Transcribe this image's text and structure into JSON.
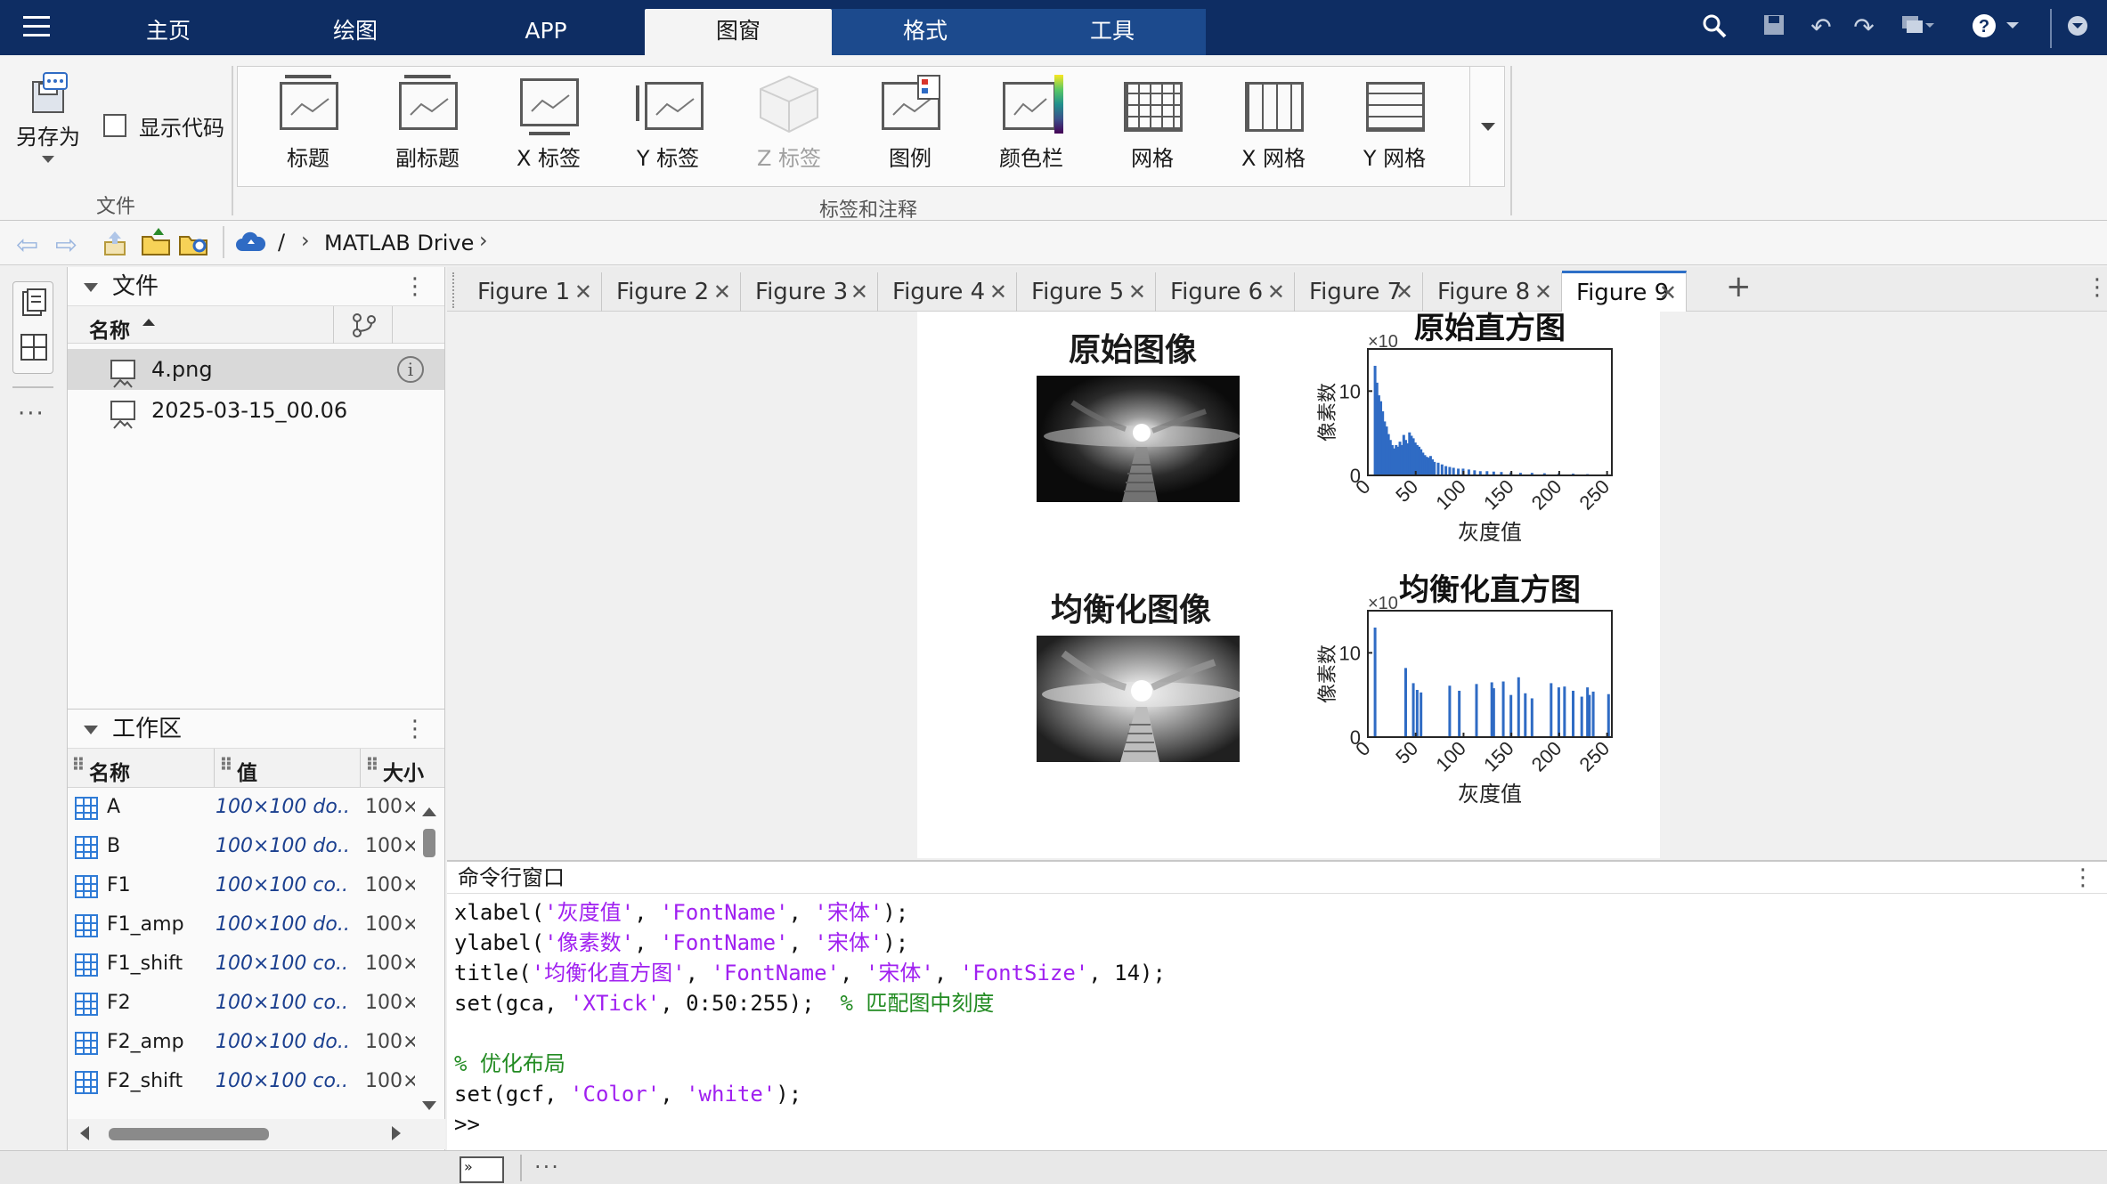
{
  "top_tabs": [
    "主页",
    "绘图",
    "APP",
    "图窗",
    "格式",
    "工具"
  ],
  "active_tab": "图窗",
  "ribbon": {
    "file_group": {
      "save_as": "另存为",
      "show_code": "显示代码",
      "group_label": "文件"
    },
    "label_group": {
      "buttons": [
        "标题",
        "副标题",
        "X 标签",
        "Y 标签",
        "Z 标签",
        "图例",
        "颜色栏",
        "网格",
        "X 网格",
        "Y 网格"
      ],
      "group_label": "标签和注释"
    }
  },
  "address": {
    "sep": "/",
    "path": "MATLAB Drive"
  },
  "files_panel": {
    "title": "文件",
    "col_name": "名称",
    "items": [
      "4.png",
      "2025-03-15_00.06"
    ]
  },
  "workspace": {
    "title": "工作区",
    "cols": [
      "名称",
      "值",
      "大小"
    ],
    "rows": [
      {
        "name": "A",
        "value": "100×100 do...",
        "size": "100×"
      },
      {
        "name": "B",
        "value": "100×100 do...",
        "size": "100×"
      },
      {
        "name": "F1",
        "value": "100×100 co...",
        "size": "100×"
      },
      {
        "name": "F1_amp",
        "value": "100×100 do...",
        "size": "100×"
      },
      {
        "name": "F1_shift",
        "value": "100×100 co...",
        "size": "100×"
      },
      {
        "name": "F2",
        "value": "100×100 co...",
        "size": "100×"
      },
      {
        "name": "F2_amp",
        "value": "100×100 do...",
        "size": "100×"
      },
      {
        "name": "F2_shift",
        "value": "100×100 co...",
        "size": "100×"
      }
    ]
  },
  "figure_tabs": [
    "Figure 1",
    "Figure 2",
    "Figure 3",
    "Figure 4",
    "Figure 5",
    "Figure 6",
    "Figure 7",
    "Figure 8",
    "Figure 9"
  ],
  "active_figure": "Figure 9",
  "figure": {
    "img1_title": "原始图像",
    "img2_title": "均衡化图像",
    "hist1_title": "原始直方图",
    "hist2_title": "均衡化直方图",
    "xlabel": "灰度值",
    "ylabel": "像素数",
    "exp_label": "×10",
    "ytick_top": "10",
    "ytick_zero": "0",
    "xticks": [
      "0",
      "50",
      "100",
      "150",
      "200",
      "250"
    ]
  },
  "chart_data": [
    {
      "type": "bar",
      "title": "原始直方图",
      "xlabel": "灰度值",
      "ylabel": "像素数",
      "xlim": [
        0,
        255
      ],
      "ylim": [
        0,
        15
      ],
      "x": [
        8,
        10,
        12,
        14,
        16,
        18,
        20,
        22,
        24,
        26,
        28,
        30,
        32,
        34,
        36,
        38,
        40,
        42,
        44,
        46,
        48,
        50,
        52,
        54,
        56,
        58,
        60,
        62,
        64,
        66,
        68,
        70,
        74,
        78,
        82,
        86,
        90,
        95,
        100,
        106,
        112,
        118,
        125,
        132,
        140,
        150,
        160,
        172,
        185,
        200,
        215,
        230,
        245
      ],
      "values": [
        13,
        11,
        9.5,
        8.8,
        7.6,
        6.4,
        5.8,
        4.9,
        4.2,
        3.6,
        3.2,
        3.6,
        3.4,
        4.0,
        3.6,
        4.8,
        4.2,
        3.8,
        5.1,
        4.7,
        4.4,
        3.9,
        3.6,
        3.4,
        3.1,
        2.7,
        2.4,
        2.2,
        2.1,
        2.3,
        1.9,
        1.6,
        1.5,
        1.3,
        1.1,
        1.0,
        0.9,
        0.8,
        0.8,
        0.7,
        0.6,
        0.5,
        0.5,
        0.45,
        0.4,
        0.35,
        0.3,
        0.3,
        0.25,
        0.2,
        0.2,
        0.15,
        0.1
      ]
    },
    {
      "type": "bar",
      "title": "均衡化直方图",
      "xlabel": "灰度值",
      "ylabel": "像素数",
      "xlim": [
        0,
        255
      ],
      "ylim": [
        0,
        15
      ],
      "x": [
        8,
        40,
        48,
        52,
        56,
        86,
        96,
        114,
        130,
        132,
        142,
        150,
        158,
        165,
        172,
        192,
        200,
        206,
        215,
        224,
        230,
        232,
        236,
        252
      ],
      "values": [
        13,
        8.2,
        6.4,
        5.6,
        5.3,
        6.1,
        5.5,
        6.3,
        6.5,
        5.8,
        6.6,
        5.0,
        7.1,
        5.2,
        4.6,
        6.4,
        5.9,
        6.0,
        5.5,
        4.8,
        5.9,
        5.0,
        5.4,
        5.1
      ]
    }
  ],
  "command_window": {
    "title": "命令行窗口",
    "lines": [
      [
        {
          "t": "xlabel(",
          "c": "n"
        },
        {
          "t": "'灰度值'",
          "c": "s"
        },
        {
          "t": ", ",
          "c": "n"
        },
        {
          "t": "'FontName'",
          "c": "s"
        },
        {
          "t": ", ",
          "c": "n"
        },
        {
          "t": "'宋体'",
          "c": "s"
        },
        {
          "t": ");",
          "c": "n"
        }
      ],
      [
        {
          "t": "ylabel(",
          "c": "n"
        },
        {
          "t": "'像素数'",
          "c": "s"
        },
        {
          "t": ", ",
          "c": "n"
        },
        {
          "t": "'FontName'",
          "c": "s"
        },
        {
          "t": ", ",
          "c": "n"
        },
        {
          "t": "'宋体'",
          "c": "s"
        },
        {
          "t": ");",
          "c": "n"
        }
      ],
      [
        {
          "t": "title(",
          "c": "n"
        },
        {
          "t": "'均衡化直方图'",
          "c": "s"
        },
        {
          "t": ", ",
          "c": "n"
        },
        {
          "t": "'FontName'",
          "c": "s"
        },
        {
          "t": ", ",
          "c": "n"
        },
        {
          "t": "'宋体'",
          "c": "s"
        },
        {
          "t": ", ",
          "c": "n"
        },
        {
          "t": "'FontSize'",
          "c": "s"
        },
        {
          "t": ", 14);",
          "c": "n"
        }
      ],
      [
        {
          "t": "set(gca, ",
          "c": "n"
        },
        {
          "t": "'XTick'",
          "c": "s"
        },
        {
          "t": ", 0:50:255);  ",
          "c": "n"
        },
        {
          "t": "% 匹配图中刻度",
          "c": "c"
        }
      ],
      [],
      [
        {
          "t": "% 优化布局",
          "c": "c"
        }
      ],
      [
        {
          "t": "set(gcf, ",
          "c": "n"
        },
        {
          "t": "'Color'",
          "c": "s"
        },
        {
          "t": ", ",
          "c": "n"
        },
        {
          "t": "'white'",
          "c": "s"
        },
        {
          "t": ");",
          "c": "n"
        }
      ],
      [
        {
          "t": ">>",
          "c": "n"
        }
      ]
    ]
  },
  "colors": {
    "topbar": "#0e2d63",
    "accent": "#2d6fc7",
    "bar": "#2f6bc4",
    "string": "#a020f0",
    "comment": "#228b22"
  }
}
